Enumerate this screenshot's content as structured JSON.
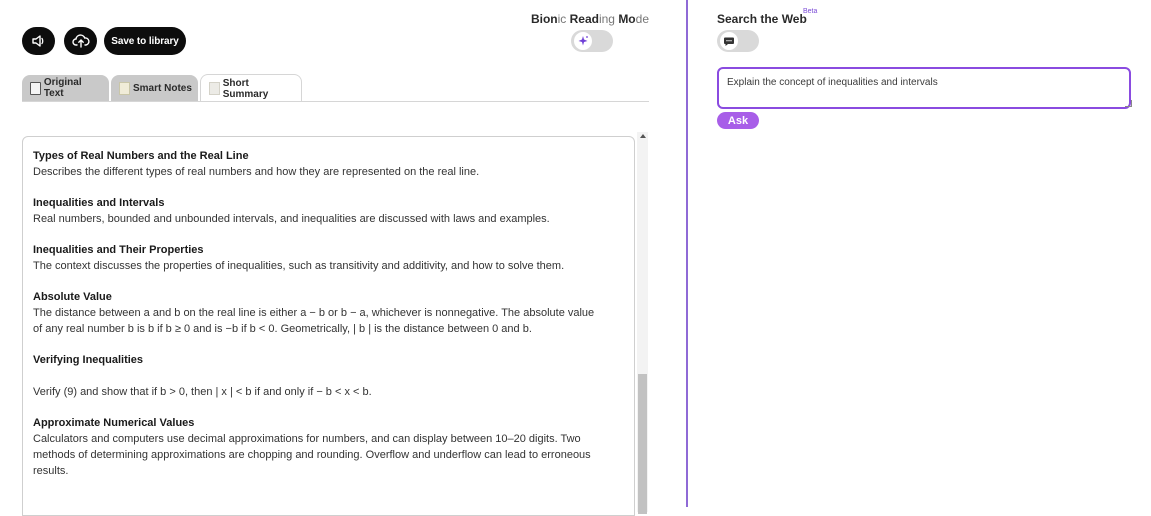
{
  "toolbar": {
    "save_label": "Save to library"
  },
  "bionic": {
    "label_parts": [
      "Bion",
      "ic ",
      "Read",
      "ing ",
      "Mo",
      "de"
    ]
  },
  "tabs": [
    {
      "label": "Original Text"
    },
    {
      "label": "Smart Notes"
    },
    {
      "label": "Short Summary"
    }
  ],
  "summary": [
    {
      "title": "Types of Real Numbers and the Real Line",
      "body": "Describes the different types of real numbers and how they are represented on the real line."
    },
    {
      "title": "Inequalities and Intervals",
      "body": "Real numbers, bounded and unbounded intervals, and inequalities are discussed with laws and examples."
    },
    {
      "title": "Inequalities and Their Properties",
      "body": "The context discusses the properties of inequalities, such as transitivity and additivity, and how to solve them."
    },
    {
      "title": "Absolute Value",
      "body": "The distance between a and b on the real line is either a − b or b − a, whichever is nonnegative. The absolute value of any real number b is b if b ≥ 0 and is −b if b < 0. Geometrically, | b | is the distance between 0 and b."
    },
    {
      "title": "Verifying Inequalities",
      "body": "Verify (9) and show that if b > 0, then | x | < b if and only if − b < x < b."
    },
    {
      "title": "Approximate Numerical Values",
      "body": "Calculators and computers use decimal approximations for numbers, and can display between 10–20 digits. Two methods of determining approximations are chopping and rounding. Overflow and underflow can lead to erroneous results."
    }
  ],
  "search": {
    "label": "Search the Web",
    "badge": "Beta",
    "question_value": "Explain the concept of inequalities and intervals",
    "ask_label": "Ask"
  },
  "colors": {
    "accent": "#8a4be0",
    "ask_button": "#a85ee8",
    "divider": "#8f6ad6"
  }
}
